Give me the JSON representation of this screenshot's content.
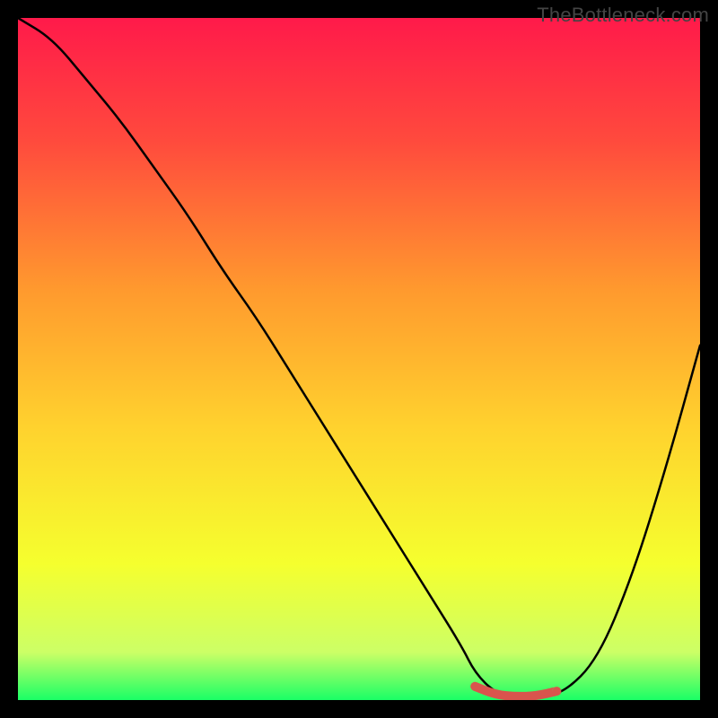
{
  "watermark": "TheBottleneck.com",
  "chart_data": {
    "type": "line",
    "title": "",
    "xlabel": "",
    "ylabel": "",
    "xlim": [
      0,
      100
    ],
    "ylim": [
      0,
      100
    ],
    "grid": false,
    "series": [
      {
        "name": "curve",
        "x": [
          0,
          5,
          10,
          15,
          20,
          25,
          30,
          35,
          40,
          45,
          50,
          55,
          60,
          65,
          67,
          70,
          73,
          76,
          80,
          85,
          90,
          95,
          100
        ],
        "values": [
          100,
          97,
          91,
          85,
          78,
          71,
          63,
          56,
          48,
          40,
          32,
          24,
          16,
          8,
          4,
          1,
          0.5,
          0.5,
          1,
          6,
          18,
          34,
          52
        ]
      }
    ],
    "highlight": {
      "name": "minimum-band",
      "x": [
        67,
        70,
        73,
        76,
        79
      ],
      "values": [
        2.0,
        0.8,
        0.5,
        0.6,
        1.3
      ],
      "color": "#d9544d"
    },
    "background_gradient": {
      "stops": [
        {
          "offset": 0,
          "color": "#ff1a4a"
        },
        {
          "offset": 0.18,
          "color": "#ff4a3d"
        },
        {
          "offset": 0.4,
          "color": "#ff9a2e"
        },
        {
          "offset": 0.6,
          "color": "#ffd22e"
        },
        {
          "offset": 0.8,
          "color": "#f5ff2e"
        },
        {
          "offset": 0.93,
          "color": "#ccff66"
        },
        {
          "offset": 1.0,
          "color": "#1aff66"
        }
      ]
    }
  }
}
